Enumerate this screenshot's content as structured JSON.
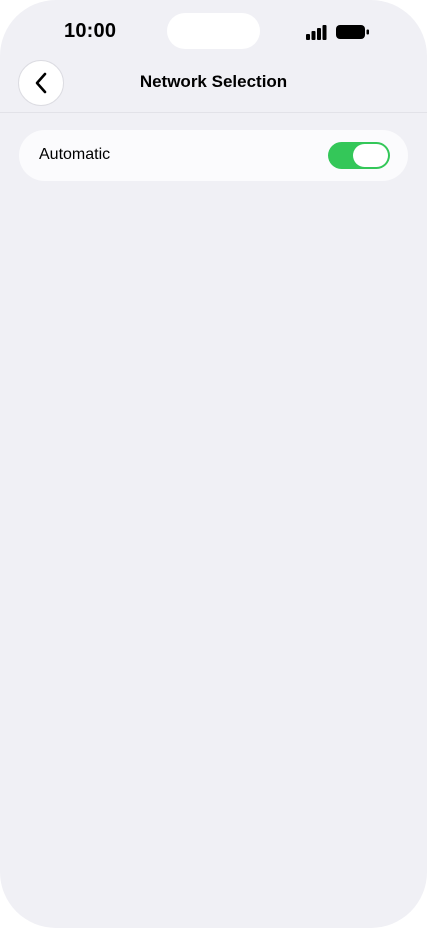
{
  "status_bar": {
    "time": "10:00",
    "signal_icon": "cellular-signal-icon",
    "battery_icon": "battery-icon"
  },
  "nav": {
    "back_icon": "chevron-left-icon",
    "title": "Network Selection"
  },
  "settings": {
    "automatic": {
      "label": "Automatic",
      "enabled": true
    }
  },
  "colors": {
    "background": "#f0f0f5",
    "card": "#fbfbfd",
    "toggle_on": "#34c759"
  }
}
